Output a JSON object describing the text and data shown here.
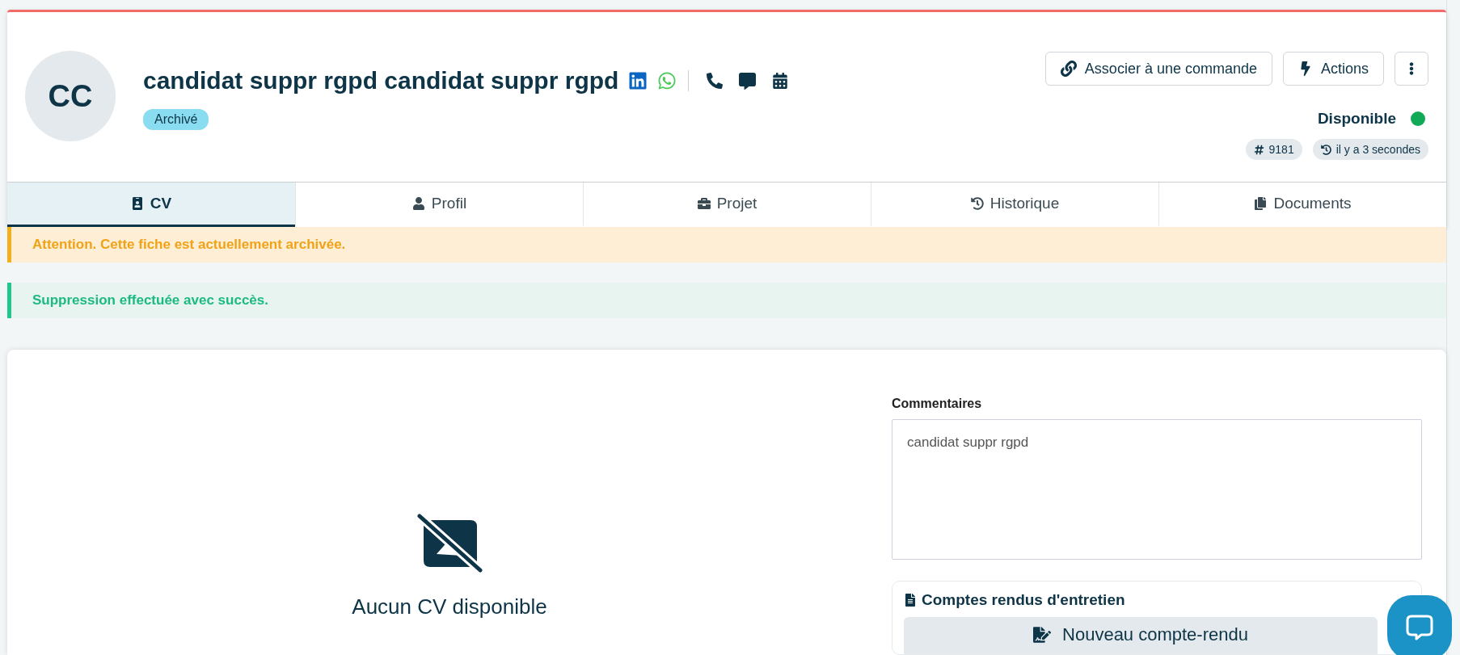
{
  "candidate": {
    "initials": "CC",
    "name": "candidat suppr rgpd candidat suppr rgpd",
    "status_badge": "Archivé",
    "availability": "Disponible",
    "id_chip": "9181",
    "updated_chip": "il y a 3 secondes"
  },
  "contact_icons": [
    {
      "kind": "linkedin"
    },
    {
      "kind": "whatsapp"
    },
    {
      "kind": "separator"
    },
    {
      "kind": "phone"
    },
    {
      "kind": "message"
    },
    {
      "kind": "calendar"
    }
  ],
  "header_buttons": [
    {
      "kind": "link",
      "label": "Associer à une commande"
    },
    {
      "kind": "bolt",
      "label": "Actions"
    },
    {
      "kind": "more"
    }
  ],
  "tabs": [
    {
      "kind": "cv",
      "label": "CV",
      "selected": true
    },
    {
      "kind": "user",
      "label": "Profil",
      "selected": false
    },
    {
      "kind": "briefcase",
      "label": "Projet",
      "selected": false
    },
    {
      "kind": "history",
      "label": "Historique",
      "selected": false
    },
    {
      "kind": "copy",
      "label": "Documents",
      "selected": false
    }
  ],
  "alerts": [
    {
      "kind": "warning",
      "text": "Attention. Cette fiche est actuellement archivée."
    },
    {
      "kind": "success",
      "text": "Suppression effectuée avec succès."
    }
  ],
  "cv_panel": {
    "empty_text": "Aucun CV disponible"
  },
  "comments": {
    "label": "Commentaires",
    "value": "candidat suppr rgpd"
  },
  "interview_reports": {
    "title": "Comptes rendus d'entretien",
    "button": "Nouveau compte-rendu"
  }
}
